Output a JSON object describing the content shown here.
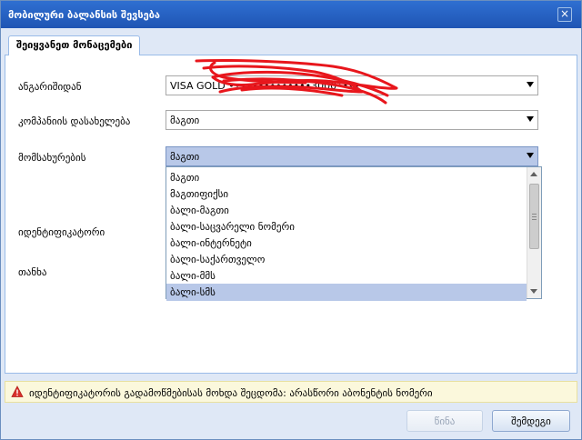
{
  "window": {
    "title": "მობილური ბალანსის შევსება",
    "close_glyph": "×"
  },
  "tabs": [
    {
      "label": "შეიყვანეთ მონაცემები",
      "active": true
    }
  ],
  "form": {
    "account": {
      "label": "ანგარიშიდან",
      "value": "VISA GOLD ••••••••••••••3000••••"
    },
    "company": {
      "label": "კომპანიის დასახელება",
      "value": "მაგთი"
    },
    "service": {
      "label": "მომსახურების",
      "value": "მაგთი"
    },
    "identifier": {
      "label": "იდენტიფიკატორი"
    },
    "amount": {
      "label": "თანხა"
    }
  },
  "service_dropdown": {
    "options": [
      "მაგთი",
      "მაგთიფიქსი",
      "ბალი-მაგთი",
      "ბალი-საცვარელი ნომერი",
      "ბალი-ინტერნეტი",
      "ბალი-საქართველო",
      "ბალი-მმს",
      "ბალი-სმს"
    ],
    "selected_index": 7
  },
  "warning": {
    "text": "იდენტიფიკატორის გადამოწმებისას მოხდა შეცდომა: არასწორი აბონენტის ნომერი",
    "icon": "warning-triangle-icon"
  },
  "buttons": {
    "back_label": "წინა",
    "next_label": "შემდეგი"
  },
  "colors": {
    "titlebar": "#1f55b4",
    "selection": "#b8c8e8",
    "warning_bg": "#fbf8dc",
    "warning_icon": "#d9302c",
    "redaction_scribble": "#e8161c"
  }
}
